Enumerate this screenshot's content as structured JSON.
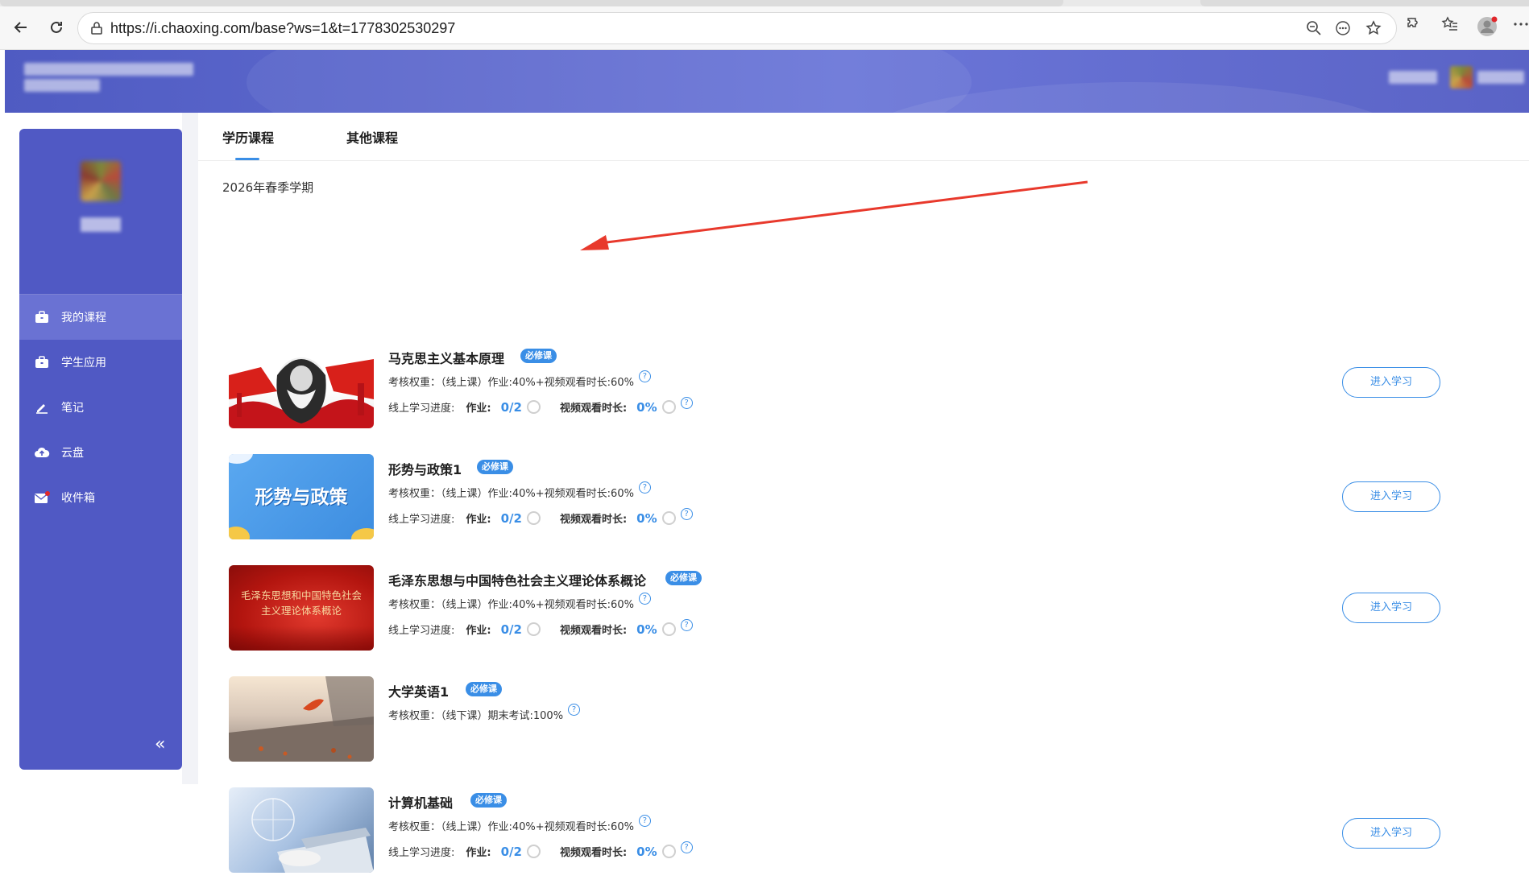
{
  "browser": {
    "url": "https://i.chaoxing.com/base?ws=1&t=1778302530297"
  },
  "tabs": [
    {
      "label": "学历课程",
      "active": true
    },
    {
      "label": "其他课程",
      "active": false
    }
  ],
  "sidebar": {
    "items": [
      {
        "label": "我的课程",
        "icon": "briefcase-icon",
        "active": true
      },
      {
        "label": "学生应用",
        "icon": "briefcase-icon",
        "active": false
      },
      {
        "label": "笔记",
        "icon": "pen-icon",
        "active": false
      },
      {
        "label": "云盘",
        "icon": "cloud-upload-icon",
        "active": false
      },
      {
        "label": "收件箱",
        "icon": "mail-icon",
        "active": false
      }
    ],
    "collapse_glyph": "«"
  },
  "semester": "2026年春季学期",
  "courses": [
    {
      "title": "马克思主义基本原理",
      "badge": "必修课",
      "weight": "考核权重：（线上课）作业:40%+视频观看时长:60%",
      "progress_label": "线上学习进度:",
      "homework_label": "作业:",
      "homework_value": "0/2",
      "video_label": "视频观看时长:",
      "video_value": "0%",
      "button": "进入学习",
      "thumb_text": ""
    },
    {
      "title": "形势与政策1",
      "badge": "必修课",
      "weight": "考核权重：（线上课）作业:40%+视频观看时长:60%",
      "progress_label": "线上学习进度:",
      "homework_label": "作业:",
      "homework_value": "0/2",
      "video_label": "视频观看时长:",
      "video_value": "0%",
      "button": "进入学习",
      "thumb_text": "形势与政策"
    },
    {
      "title": "毛泽东思想与中国特色社会主义理论体系概论",
      "badge": "必修课",
      "weight": "考核权重：（线上课）作业:40%+视频观看时长:60%",
      "progress_label": "线上学习进度:",
      "homework_label": "作业:",
      "homework_value": "0/2",
      "video_label": "视频观看时长:",
      "video_value": "0%",
      "button": "进入学习",
      "thumb_text": "毛泽东思想和中国特色社会主义理论体系概论"
    },
    {
      "title": "大学英语1",
      "badge": "必修课",
      "weight": "考核权重：（线下课）期末考试:100%",
      "thumb_text": ""
    },
    {
      "title": "计算机基础",
      "badge": "必修课",
      "weight": "考核权重：（线上课）作业:40%+视频观看时长:60%",
      "progress_label": "线上学习进度:",
      "homework_label": "作业:",
      "homework_value": "0/2",
      "video_label": "视频观看时长:",
      "video_value": "0%",
      "button": "进入学习",
      "thumb_text": ""
    }
  ],
  "colors": {
    "accent": "#3a8ee6",
    "sidebar": "#5059c4",
    "annotation_arrow": "#e8392c"
  }
}
